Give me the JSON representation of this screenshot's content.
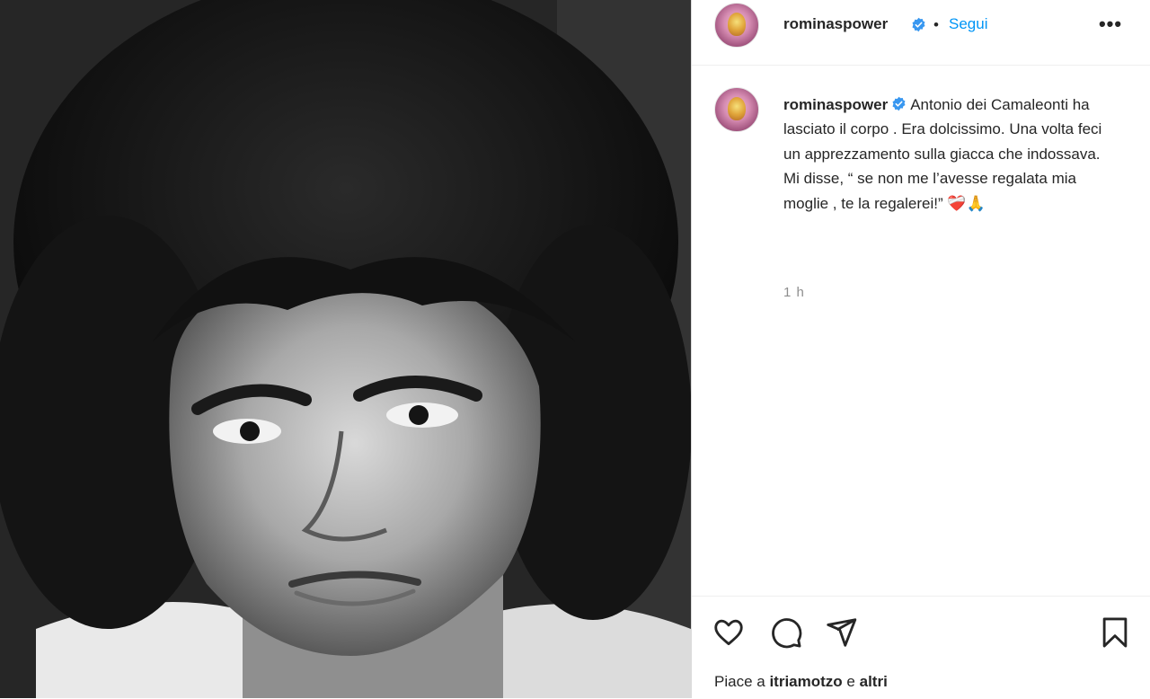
{
  "post": {
    "image_alt": "black-and-white portrait of a young man with curly hair"
  },
  "header": {
    "username": "rominaspower",
    "separator": "•",
    "follow_label": "Segui",
    "more_label": "•••"
  },
  "caption": {
    "username": "rominaspower",
    "text": "Antonio dei Camaleonti ha lasciato il corpo . Era dolcissimo. Una volta feci un apprezzamento sulla giacca che indossava. Mi disse, “ se non me l’avesse regalata mia moglie , te la regalerei!” ❤️‍🩹🙏",
    "timestamp": "1 h"
  },
  "actions": {
    "icons": [
      "heart-icon",
      "comment-icon",
      "share-icon",
      "bookmark-icon"
    ],
    "likes_prefix": "Piace a",
    "likes_user": "itriamotzo",
    "likes_connector": "e",
    "likes_others": "altri"
  },
  "colors": {
    "accent": "#0095f6",
    "verified": "#3897f0",
    "text": "#262626",
    "muted": "#8e8e8e"
  }
}
